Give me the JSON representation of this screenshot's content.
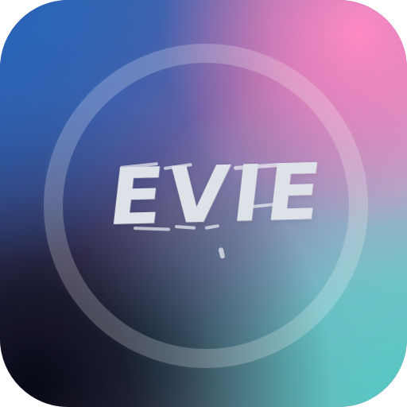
{
  "app_icon": {
    "label": "EVIE",
    "colors": {
      "top_left": "#2c60ad",
      "top_right": "#f48ab8",
      "bottom_left": "#05080f",
      "bottom_right": "#56dbd3",
      "ring": "#ffffff",
      "text": "#dde1e8"
    },
    "icon_name": "ring-icon"
  }
}
